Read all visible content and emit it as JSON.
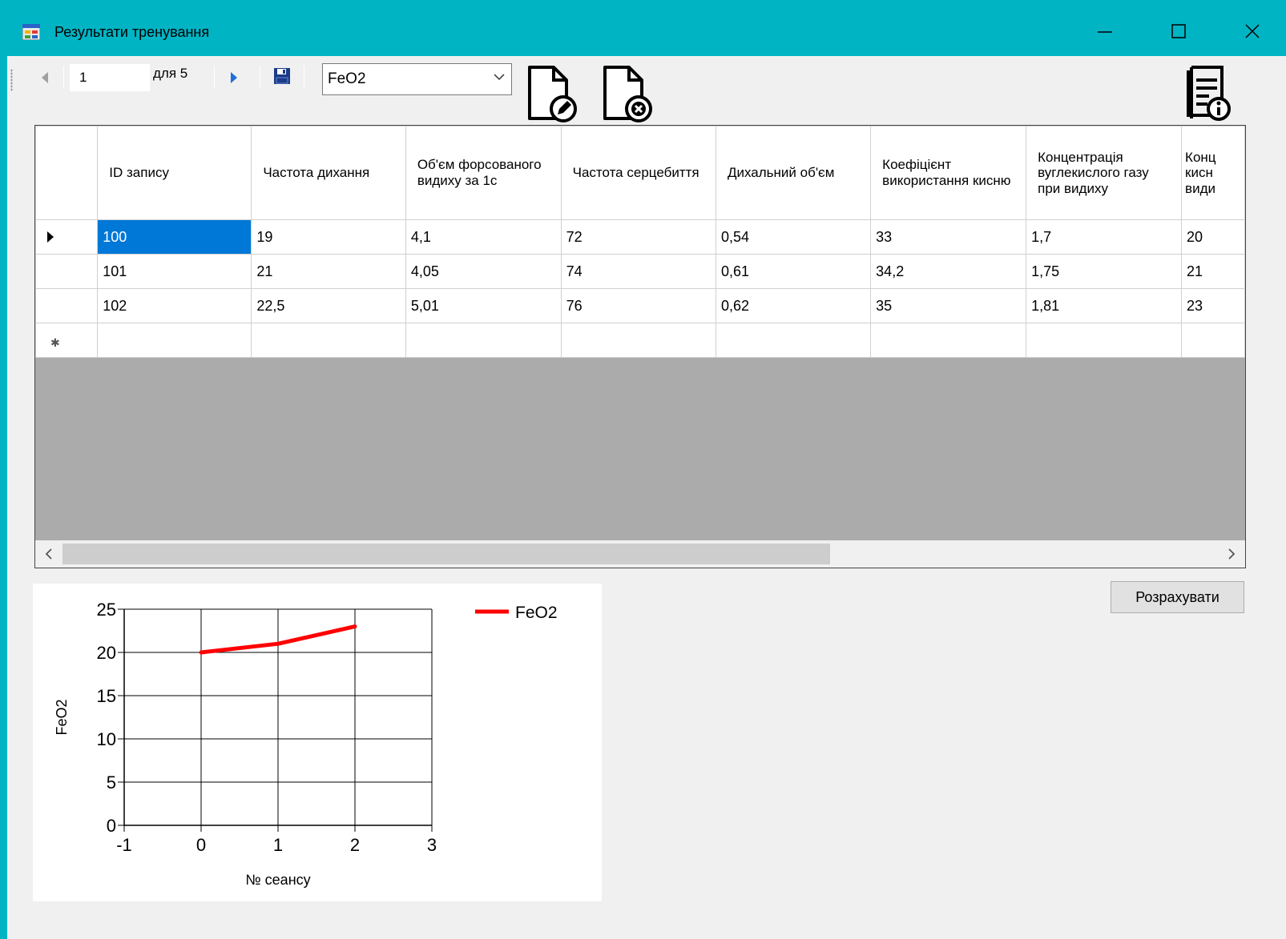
{
  "window": {
    "title": "Результати тренування",
    "minimize_glyph": "—",
    "maximize_glyph": "☐",
    "close_glyph": "✕"
  },
  "toolbar": {
    "position_value": "1",
    "count_label": "для 5",
    "combo_value": "FeO2",
    "icons": [
      "move-previous-icon",
      "move-next-icon",
      "save-icon",
      "edit-document-icon",
      "delete-document-icon",
      "info-report-icon"
    ]
  },
  "grid": {
    "columns": [
      "ID запису",
      "Частота дихання",
      "Об'єм форсованого видиху за 1с",
      "Частота серцебиття",
      "Дихальний об'єм",
      "Коефіцієнт використання кисню",
      "Концентрація вуглекислого газу при видиху",
      "Конц кисн види"
    ],
    "rows": [
      [
        "100",
        "19",
        "4,1",
        "72",
        "0,54",
        "33",
        "1,7",
        "20"
      ],
      [
        "101",
        "21",
        "4,05",
        "74",
        "0,61",
        "34,2",
        "1,75",
        "21"
      ],
      [
        "102",
        "22,5",
        "5,01",
        "76",
        "0,62",
        "35",
        "1,81",
        "23"
      ]
    ],
    "selected_cell": "100"
  },
  "buttons": {
    "calculate": "Розрахувати"
  },
  "chart_data": {
    "type": "line",
    "xlabel": "№ сеансу",
    "ylabel": "FeO2",
    "xlim": [
      -1,
      3
    ],
    "ylim": [
      0,
      25
    ],
    "x_ticks": [
      "-1",
      "0",
      "1",
      "2",
      "3"
    ],
    "y_ticks": [
      "0",
      "5",
      "10",
      "15",
      "20",
      "25"
    ],
    "grid": true,
    "legend_position": "top-right",
    "series": [
      {
        "name": "FeO2",
        "color": "#ff0000",
        "x": [
          0,
          1,
          2
        ],
        "values": [
          20,
          21,
          23
        ]
      }
    ]
  }
}
